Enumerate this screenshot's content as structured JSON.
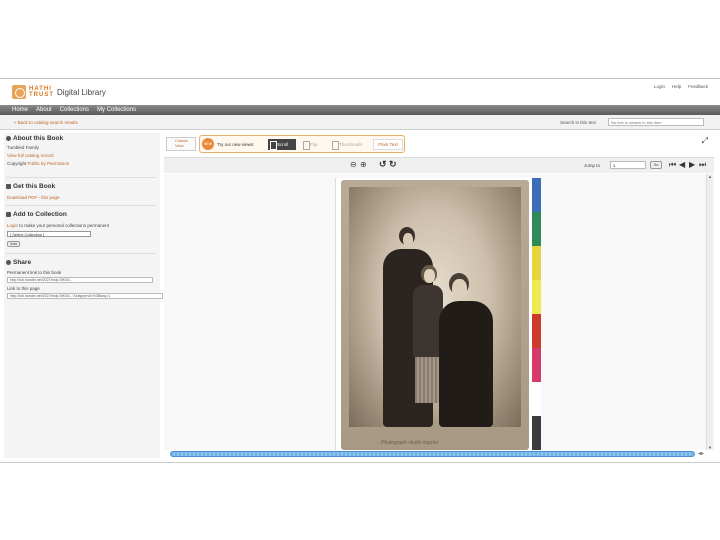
{
  "header": {
    "logo_text": "HATHI TRUST",
    "logo_sub": "Digital Library",
    "util_links": [
      "Login",
      "Help",
      "Feedback"
    ]
  },
  "nav": {
    "items": [
      "Home",
      "About",
      "Collections",
      "My Collections"
    ]
  },
  "subbar": {
    "back_link": "« Back to catalog search results",
    "search_label": "Search in this text",
    "search_placeholder": "No text to search in this item"
  },
  "sidebar": {
    "about_title": "About this Book",
    "book_title": "Tumbled Family",
    "catalog_link": "View full catalog record",
    "copyright_label": "Copyright",
    "copyright_value": "Public by Permission",
    "get_title": "Get this Book",
    "download_link": "Download PDF - this page",
    "collection_title": "Add to Collection",
    "login_link": "Login",
    "login_note": "to make your personal collections permanent",
    "select_value": "[ Select Collection ]",
    "add_button": "Add",
    "share_title": "Share",
    "permalink_label": "Permanent link to this book",
    "permalink_value": "http://hdl.handle.net/2027/mdp.39015...",
    "pagelink_label": "Link to this page",
    "pagelink_value": "http://hdl.handle.net/2027/mdp.39015...?urlappend=%3Bseq=1"
  },
  "toolbar": {
    "classic_view": "Classic View",
    "new_badge": "NEW",
    "try_text": "Try our new views:",
    "scroll": "Scroll",
    "flip": "Flip",
    "thumbnails": "Thumbnails",
    "plain_text": "Plain Text"
  },
  "controls": {
    "jump_label": "Jump to",
    "jump_value": "1",
    "go_button": "Go"
  },
  "page": {
    "imprint": "Photograph studio imprint"
  },
  "colors": {
    "accent": "#c0662a",
    "swatches": [
      "#3a6fb5",
      "#2e8b57",
      "#e6d43a",
      "#f0e850",
      "#cc3b2b",
      "#d63a6a",
      "#ffffff",
      "#3c3c3c"
    ]
  }
}
